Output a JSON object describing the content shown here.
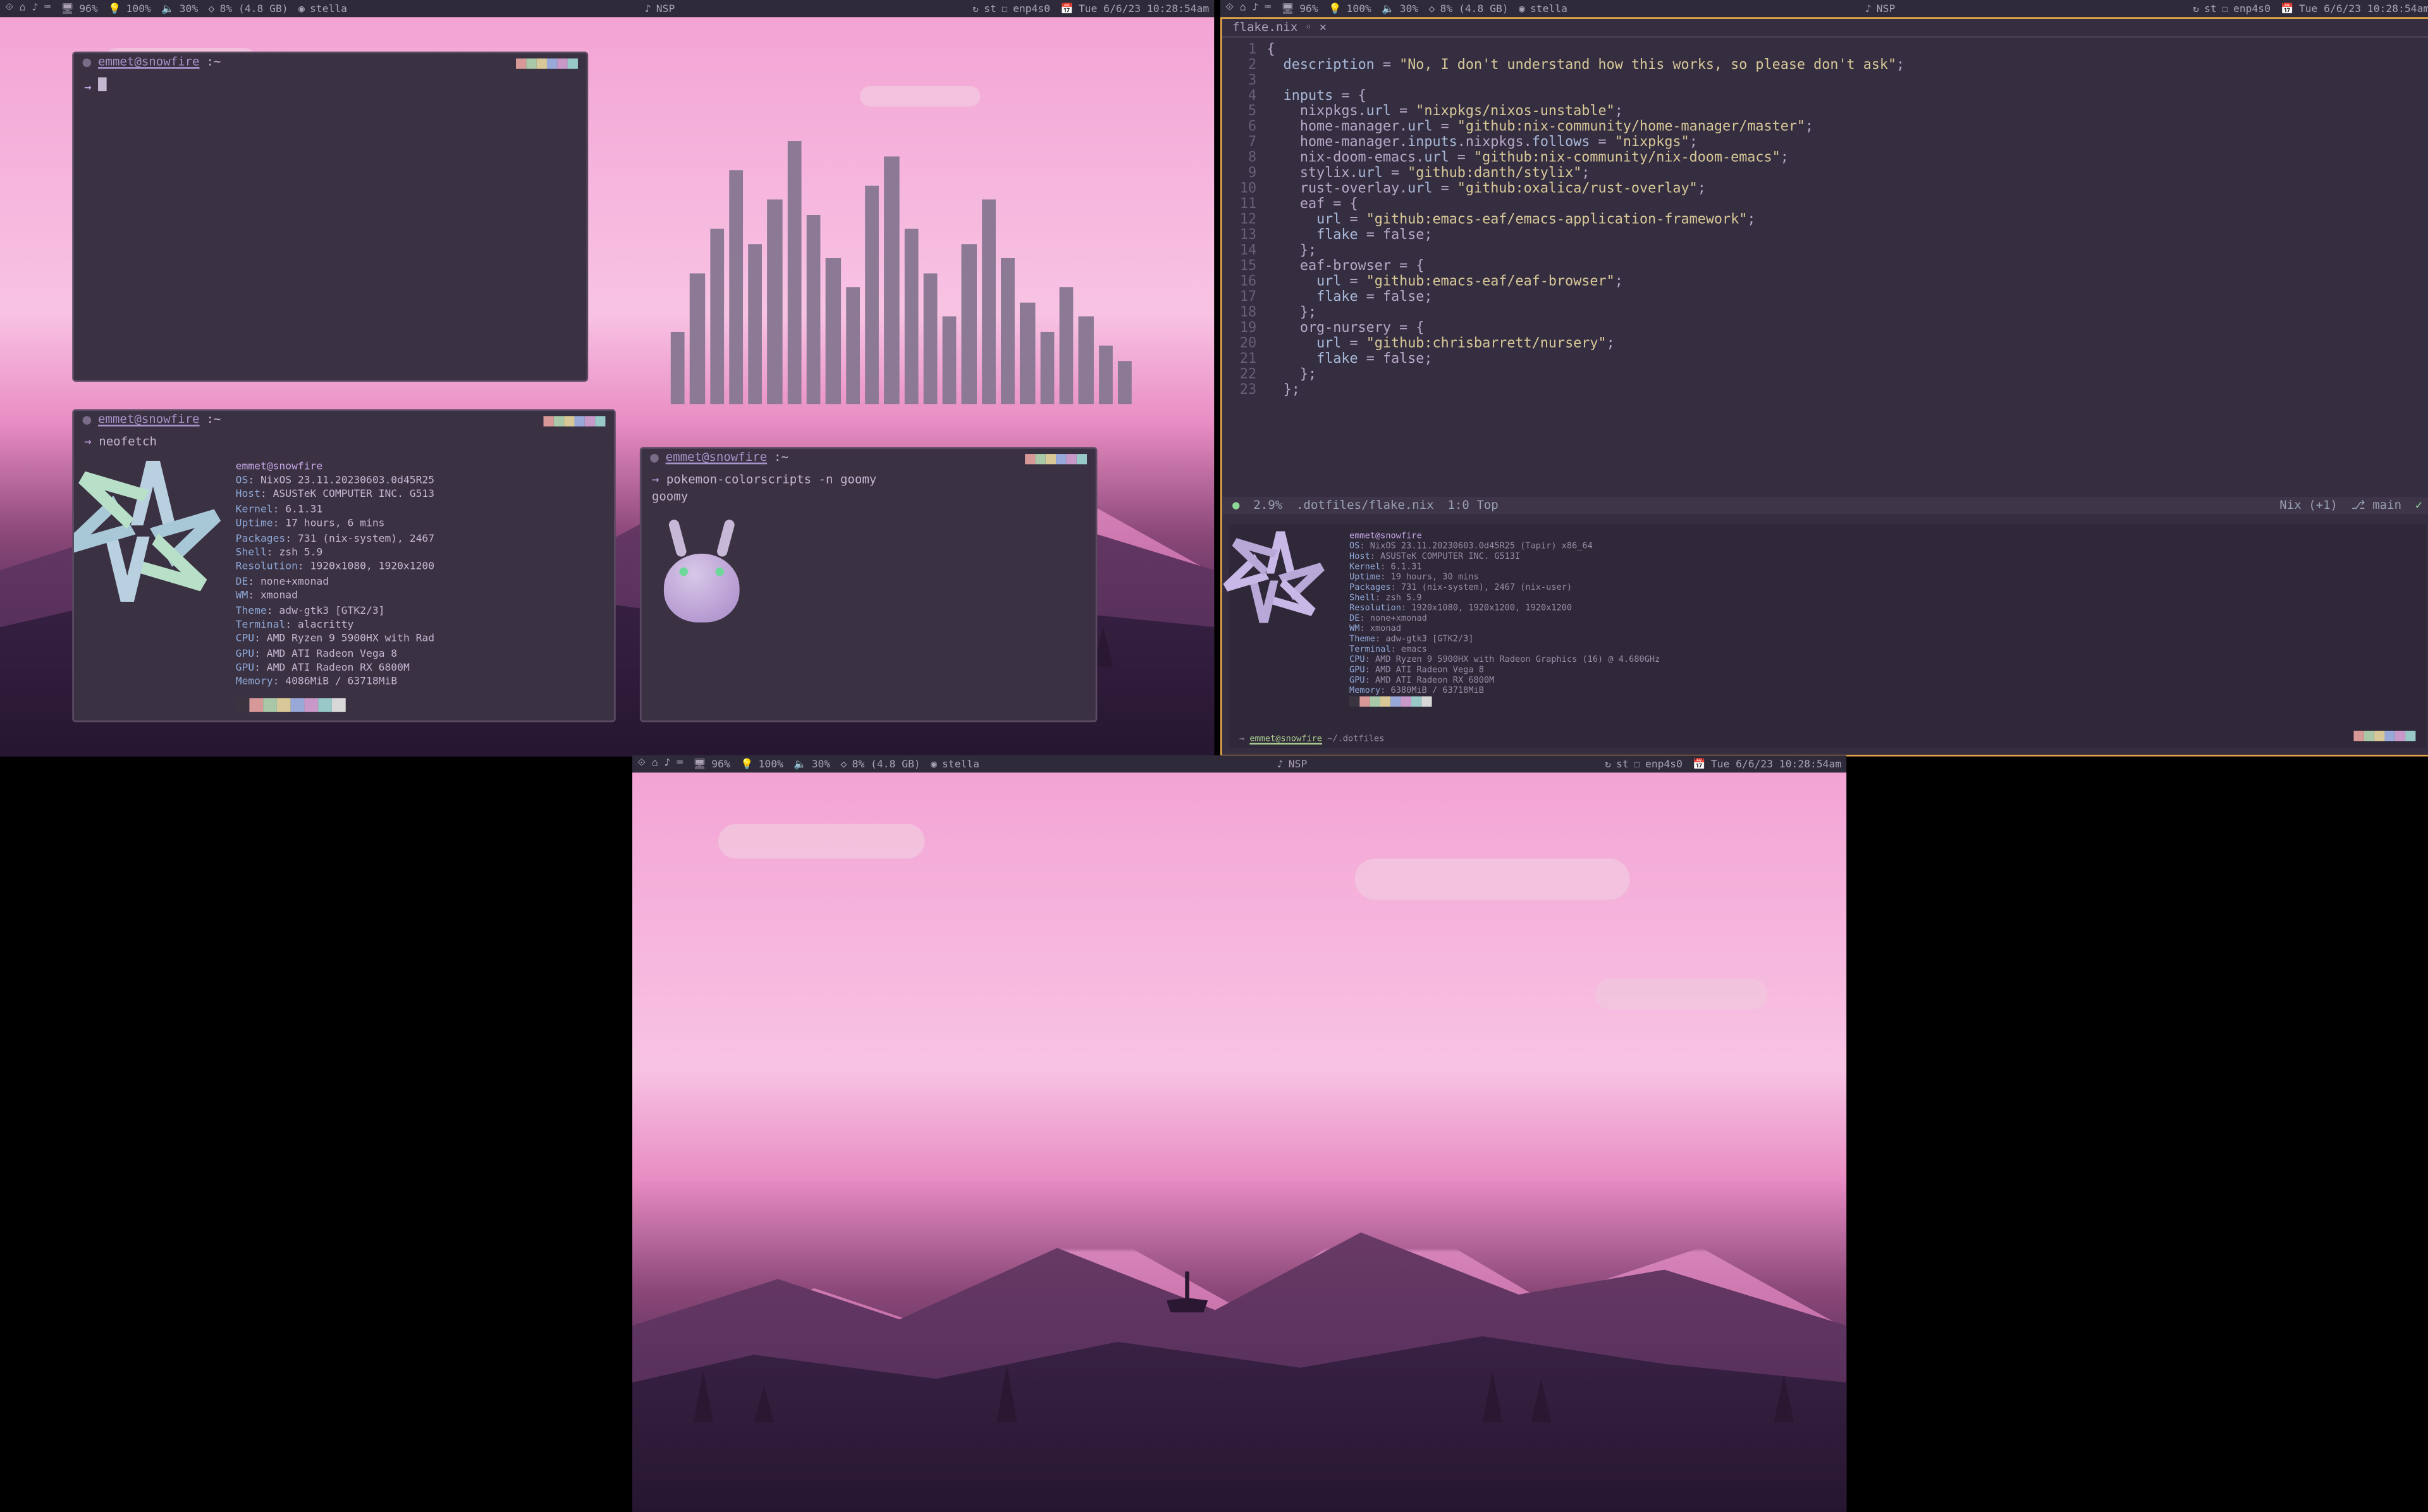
{
  "topbar": {
    "cpu": "96%",
    "battery": "100%",
    "volume": "30%",
    "memory": "8% (4.8 GB)",
    "hostname": "stella",
    "media_label": "NSP",
    "network_down": "st",
    "network_iface": "enp4s0",
    "datetime": "Tue 6/6/23 10:28:54am",
    "workspace_icons": "⟐ ⌂ ♪ ⌨"
  },
  "terminals": {
    "t1": {
      "title_user": "emmet@snowfire",
      "title_path": ":~",
      "prompt": "→ "
    },
    "t2": {
      "title_user": "emmet@snowfire",
      "title_path": ":~",
      "cmd": "neofetch",
      "neofetch": {
        "header": "emmet@snowfire",
        "rows": [
          [
            "OS",
            "NixOS 23.11.20230603.0d45R25"
          ],
          [
            "Host",
            "ASUSTeK COMPUTER INC. G513"
          ],
          [
            "Kernel",
            "6.1.31"
          ],
          [
            "Uptime",
            "17 hours, 6 mins"
          ],
          [
            "Packages",
            "731 (nix-system), 2467"
          ],
          [
            "Shell",
            "zsh 5.9"
          ],
          [
            "Resolution",
            "1920x1080, 1920x1200"
          ],
          [
            "DE",
            "none+xmonad"
          ],
          [
            "WM",
            "xmonad"
          ],
          [
            "Theme",
            "adw-gtk3 [GTK2/3]"
          ],
          [
            "Terminal",
            "alacritty"
          ],
          [
            "CPU",
            "AMD Ryzen 9 5900HX with Rad"
          ],
          [
            "GPU",
            "AMD ATI Radeon Vega 8"
          ],
          [
            "GPU",
            "AMD ATI Radeon RX 6800M"
          ],
          [
            "Memory",
            "4086MiB / 63718MiB"
          ]
        ]
      }
    },
    "t3": {
      "title_user": "emmet@snowfire",
      "title_path": ":~",
      "cmd": "pokemon-colorscripts -n goomy",
      "output": "goomy"
    }
  },
  "editor": {
    "tab": "flake.nix ◦ ×",
    "lines": [
      "{",
      "  description = \"No, I don't understand how this works, so please don't ask\";",
      "",
      "  inputs = {",
      "    nixpkgs.url = \"nixpkgs/nixos-unstable\";",
      "    home-manager.url = \"github:nix-community/home-manager/master\";",
      "    home-manager.inputs.nixpkgs.follows = \"nixpkgs\";",
      "    nix-doom-emacs.url = \"github:nix-community/nix-doom-emacs\";",
      "    stylix.url = \"github:danth/stylix\";",
      "    rust-overlay.url = \"github:oxalica/rust-overlay\";",
      "    eaf = {",
      "      url = \"github:emacs-eaf/emacs-application-framework\";",
      "      flake = false;",
      "    };",
      "    eaf-browser = {",
      "      url = \"github:emacs-eaf/eaf-browser\";",
      "      flake = false;",
      "    };",
      "    org-nursery = {",
      "      url = \"github:chrisbarrett/nursery\";",
      "      flake = false;",
      "    };",
      "  };"
    ],
    "status": {
      "mode": "●",
      "pct": "2.9%",
      "path": ".dotfiles/flake.nix",
      "pos": "1:0 Top",
      "lang": "Nix (+1)",
      "branch": "main",
      "check": "✓"
    },
    "bottom_panel": {
      "prompt_user": "emmet@snowfire",
      "prompt_path": "~/.dotfiles",
      "neofetch_header": "emmet@snowfire",
      "rows": [
        [
          "OS",
          "NixOS 23.11.20230603.0d45R25 (Tapir) x86_64"
        ],
        [
          "Host",
          "ASUSTeK COMPUTER INC. G513I"
        ],
        [
          "Kernel",
          "6.1.31"
        ],
        [
          "Uptime",
          "19 hours, 30 mins"
        ],
        [
          "Packages",
          "731 (nix-system), 2467 (nix-user)"
        ],
        [
          "Shell",
          "zsh 5.9"
        ],
        [
          "Resolution",
          "1920x1080, 1920x1200, 1920x1200"
        ],
        [
          "DE",
          "none+xmonad"
        ],
        [
          "WM",
          "xmonad"
        ],
        [
          "Theme",
          "adw-gtk3 [GTK2/3]"
        ],
        [
          "Terminal",
          "emacs"
        ],
        [
          "CPU",
          "AMD Ryzen 9 5900HX with Radeon Graphics (16) @ 4.680GHz"
        ],
        [
          "GPU",
          "AMD ATI Radeon Vega 8"
        ],
        [
          "GPU",
          "AMD ATI Radeon RX 6800M"
        ],
        [
          "Memory",
          "6380MiB / 63718MiB"
        ]
      ]
    }
  },
  "visualizer_bars": [
    25,
    45,
    60,
    80,
    55,
    70,
    90,
    65,
    50,
    40,
    75,
    85,
    60,
    45,
    30,
    55,
    70,
    50,
    35,
    25,
    40,
    30,
    20,
    15
  ],
  "colors": {
    "bg_term": "#3a3142",
    "bg_editor": "#352e40",
    "accent": "#c8a8e8",
    "string": "#d8c898"
  }
}
